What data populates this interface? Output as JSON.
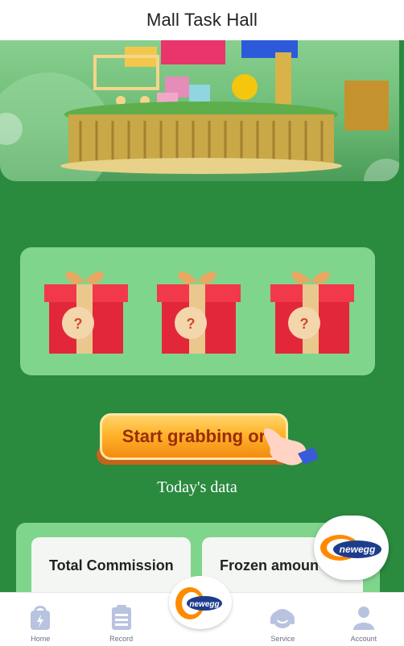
{
  "header": {
    "title": "Mall Task Hall"
  },
  "grab_button": {
    "label": "Start grabbing or"
  },
  "stats": {
    "heading": "Today's data",
    "cards": [
      {
        "title": "Total Commission"
      },
      {
        "title": "Frozen amoun"
      }
    ]
  },
  "gifts": {
    "mark": "?"
  },
  "brand": {
    "logo_text": "newegg"
  },
  "tabbar": {
    "items": [
      {
        "label": "Home",
        "icon": "home-icon"
      },
      {
        "label": "Record",
        "icon": "record-icon"
      },
      {
        "label": "Service",
        "icon": "service-icon"
      },
      {
        "label": "Account",
        "icon": "account-icon"
      }
    ]
  },
  "colors": {
    "page_bg": "#2a8a3e",
    "panel": "#7fd58b",
    "tab_icon": "#b8c3e0",
    "button": "#ffb42a"
  }
}
